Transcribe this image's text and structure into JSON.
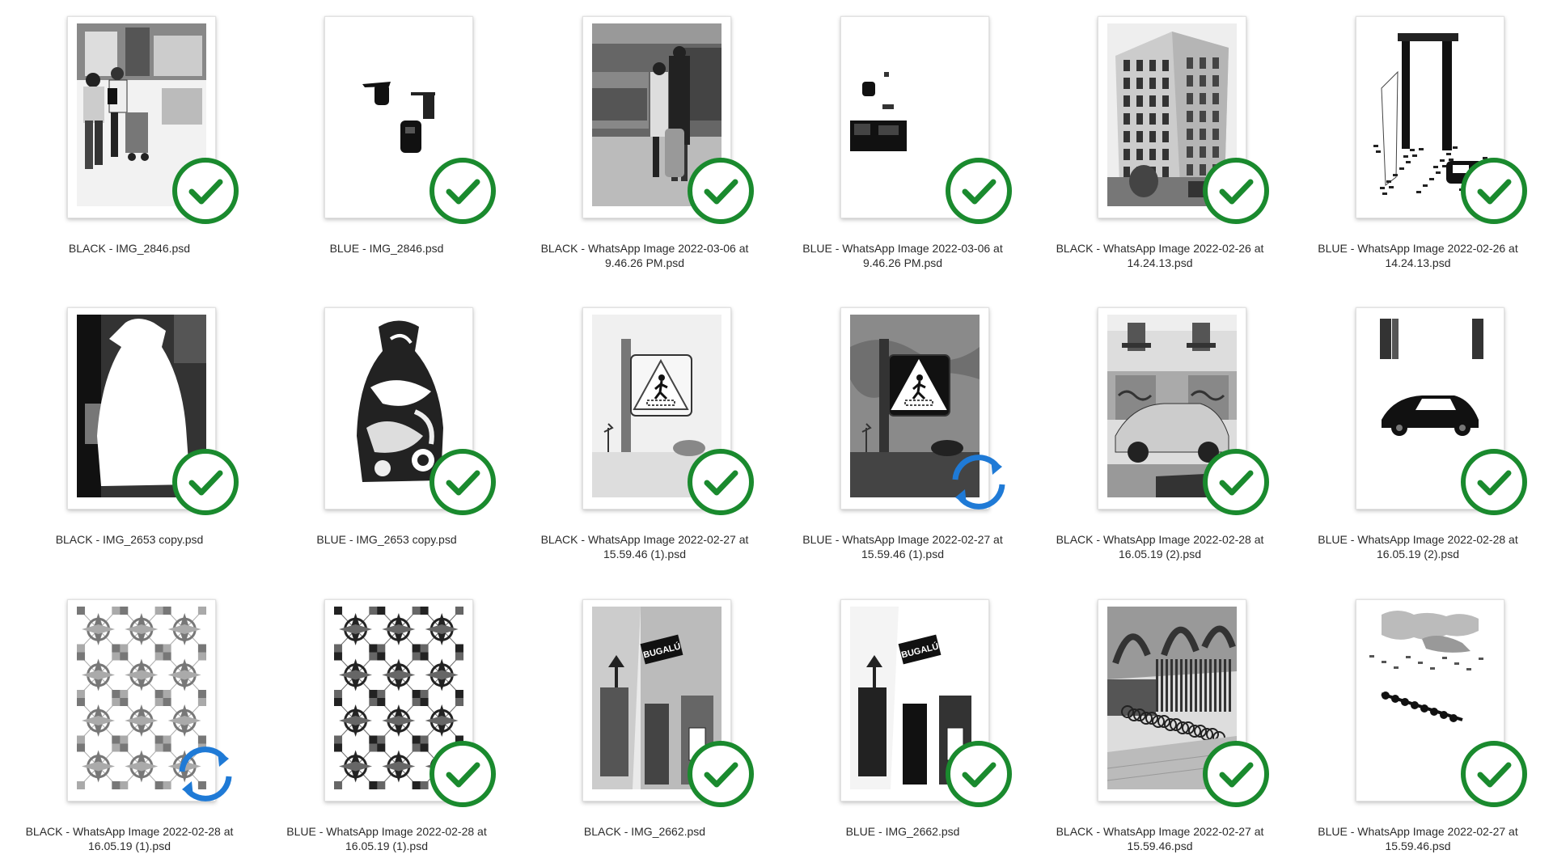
{
  "colors": {
    "synced": "#1a8a2e",
    "syncing": "#1f7ad6"
  },
  "files": [
    {
      "line1": "BLACK - IMG_2846.psd",
      "line2": "",
      "status": "synced",
      "thumb": "shoppers"
    },
    {
      "line1": "BLUE - IMG_2846.psd",
      "line2": "",
      "status": "synced",
      "thumb": "shoppers-mask"
    },
    {
      "line1": "BLACK - WhatsApp Image 2022-03-06 at",
      "line2": "9.46.26 PM.psd",
      "status": "synced",
      "thumb": "market-couple"
    },
    {
      "line1": "BLUE - WhatsApp Image 2022-03-06 at",
      "line2": "9.46.26 PM.psd",
      "status": "synced",
      "thumb": "market-mask"
    },
    {
      "line1": "BLACK - WhatsApp Image 2022-02-26 at",
      "line2": "14.24.13.psd",
      "status": "synced",
      "thumb": "building"
    },
    {
      "line1": "BLUE - WhatsApp Image 2022-02-26 at",
      "line2": "14.24.13.psd",
      "status": "synced",
      "thumb": "building-mask"
    },
    {
      "line1": "BLACK - IMG_2653 copy.psd",
      "line2": "",
      "status": "synced",
      "thumb": "vase-silhouette"
    },
    {
      "line1": "BLUE - IMG_2653 copy.psd",
      "line2": "",
      "status": "synced",
      "thumb": "vase"
    },
    {
      "line1": "BLACK - WhatsApp Image 2022-02-27 at",
      "line2": "15.59.46 (1).psd",
      "status": "synced",
      "thumb": "crossing-sign-light"
    },
    {
      "line1": "BLUE - WhatsApp Image 2022-02-27 at",
      "line2": "15.59.46 (1).psd",
      "status": "syncing",
      "thumb": "crossing-sign-dark"
    },
    {
      "line1": "BLACK - WhatsApp Image 2022-02-28 at",
      "line2": "16.05.19 (2).psd",
      "status": "synced",
      "thumb": "street-car"
    },
    {
      "line1": "BLUE - WhatsApp Image 2022-02-28 at",
      "line2": "16.05.19 (2).psd",
      "status": "synced",
      "thumb": "car-mask"
    },
    {
      "line1": "BLACK - WhatsApp Image 2022-02-28 at",
      "line2": "16.05.19 (1).psd",
      "status": "syncing",
      "thumb": "tiles-light"
    },
    {
      "line1": "BLUE - WhatsApp Image 2022-02-28 at",
      "line2": "16.05.19 (1).psd",
      "status": "synced",
      "thumb": "tiles-dark"
    },
    {
      "line1": "BLACK - IMG_2662.psd",
      "line2": "",
      "status": "synced",
      "thumb": "bugalu-street"
    },
    {
      "line1": "BLUE - IMG_2662.psd",
      "line2": "",
      "status": "synced",
      "thumb": "bugalu-ink"
    },
    {
      "line1": "BLACK - WhatsApp Image 2022-02-27 at",
      "line2": "15.59.46.psd",
      "status": "synced",
      "thumb": "bikes"
    },
    {
      "line1": "BLUE - WhatsApp Image 2022-02-27 at",
      "line2": "15.59.46.psd",
      "status": "synced",
      "thumb": "bikes-mask"
    }
  ],
  "thumb_texts": {
    "bugalu": "BUGALÚ"
  }
}
